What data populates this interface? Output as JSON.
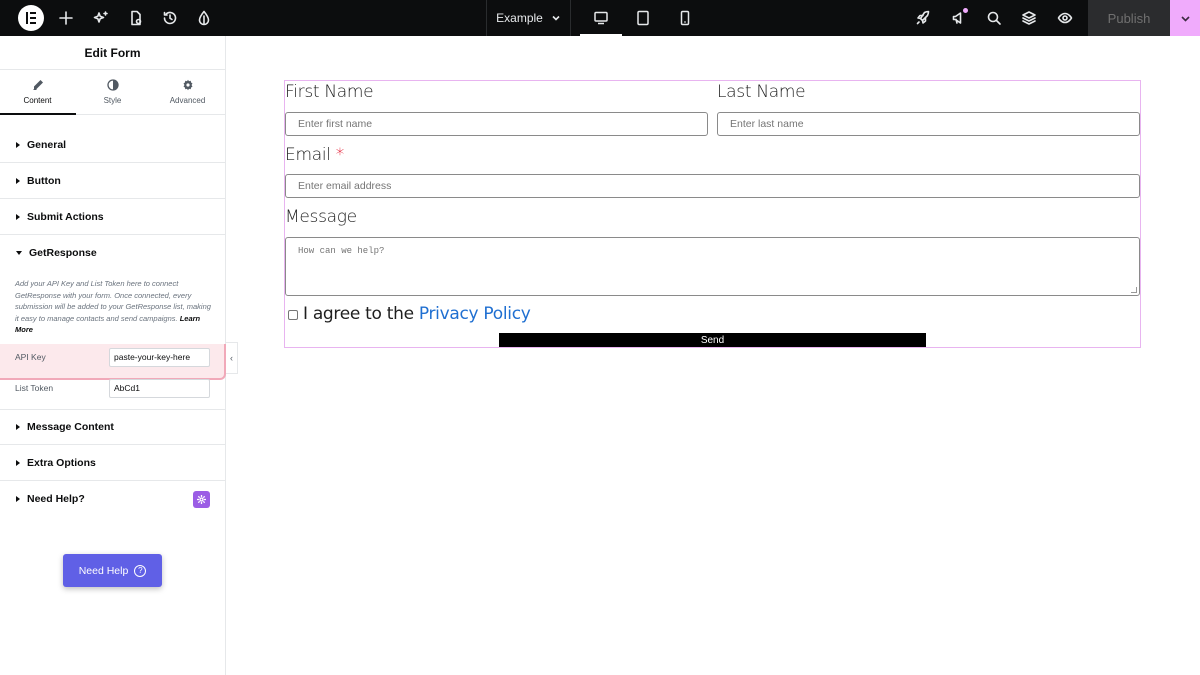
{
  "topbar": {
    "page_name": "Example",
    "publish_label": "Publish",
    "accent": "#f0abfc"
  },
  "panel": {
    "title": "Edit Form",
    "tabs": [
      {
        "label": "Content",
        "icon": "pencil-icon",
        "active": true
      },
      {
        "label": "Style",
        "icon": "half-circle-icon",
        "active": false
      },
      {
        "label": "Advanced",
        "icon": "gear-icon",
        "active": false
      }
    ],
    "sections": {
      "general": "General",
      "button": "Button",
      "submit_actions": "Submit Actions",
      "getresponse": "GetResponse",
      "message_content": "Message Content",
      "extra_options": "Extra Options",
      "need_help": "Need Help?"
    },
    "getresponse_desc": "Add your API Key and List Token here to connect GetResponse with your form. Once connected, every submission will be added to your GetResponse list, making it easy to manage contacts and send campaigns.",
    "learn_more": "Learn More",
    "api_key_label": "API Key",
    "api_key_value": "paste-your-key-here",
    "list_token_label": "List Token",
    "list_token_value": "AbCd1",
    "need_help_button": "Need Help",
    "need_help_button_icon": "?"
  },
  "form": {
    "first_name_label": "First Name",
    "first_name_placeholder": "Enter first name",
    "last_name_label": "Last Name",
    "last_name_placeholder": "Enter last name",
    "email_label": "Email",
    "email_required": "*",
    "email_placeholder": "Enter email address",
    "message_label": "Message",
    "message_placeholder": "How can we help?",
    "agree_text": "I agree to the ",
    "privacy_link": "Privacy Policy",
    "send_label": "Send"
  }
}
